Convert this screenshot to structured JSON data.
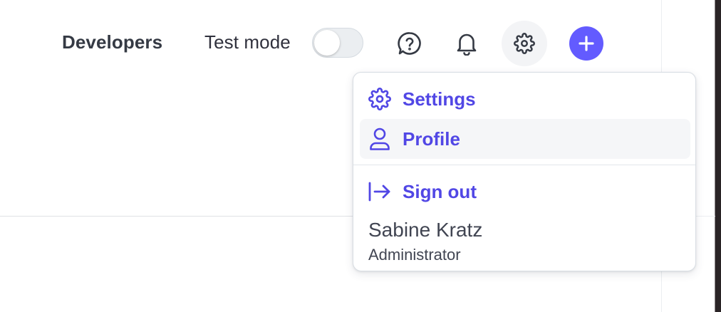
{
  "topbar": {
    "developers_label": "Developers",
    "test_mode_label": "Test mode",
    "test_mode_on": false,
    "icons": {
      "help": "help-circle-icon",
      "notifications": "bell-icon",
      "settings": "gear-icon",
      "create": "plus-icon"
    }
  },
  "menu": {
    "items": [
      {
        "label": "Settings",
        "icon": "gear-icon"
      },
      {
        "label": "Profile",
        "icon": "user-icon"
      },
      {
        "label": "Sign out",
        "icon": "sign-out-icon"
      }
    ],
    "user": {
      "name": "Sabine Kratz",
      "role": "Administrator"
    }
  },
  "colors": {
    "accent": "#635bff",
    "menu_text": "#5147e5",
    "text": "#30313d"
  }
}
